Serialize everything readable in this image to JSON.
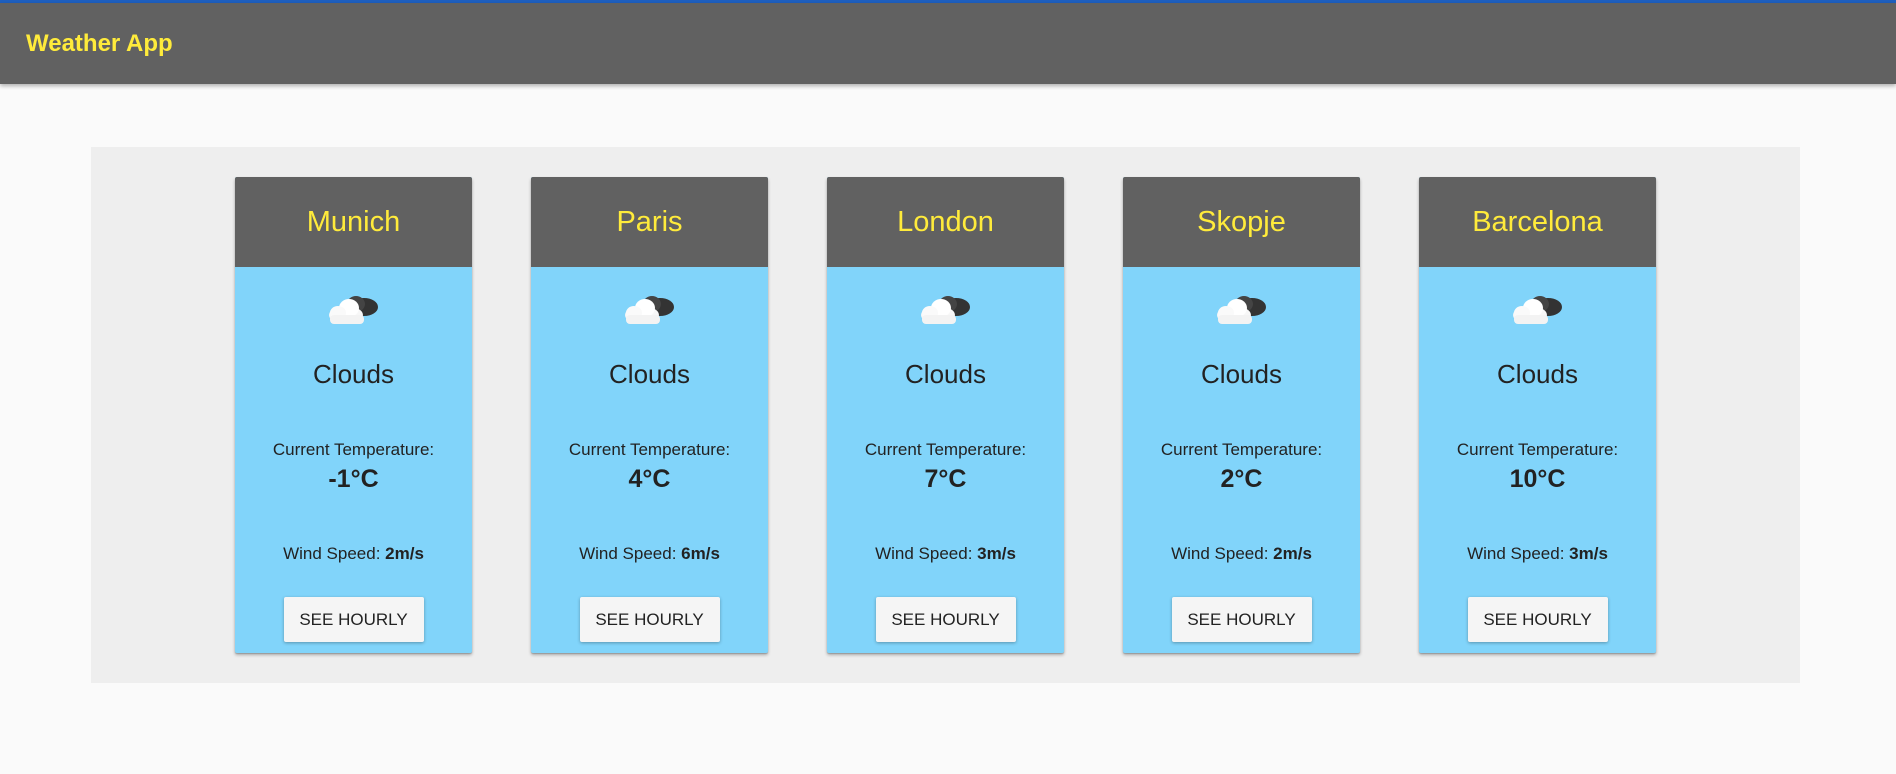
{
  "app": {
    "title": "Weather App"
  },
  "labels": {
    "temperature_label": "Current Temperature:",
    "wind_label": "Wind Speed:",
    "hourly_button": "SEE HOURLY"
  },
  "icons": {
    "weather": "cloud-icon"
  },
  "colors": {
    "header_bg": "#616161",
    "accent_text": "#ffeb3b",
    "card_bg": "#81d4fa",
    "panel_bg": "#eeeeee",
    "top_border": "#1e5fbf"
  },
  "cities": [
    {
      "name": "Munich",
      "condition": "Clouds",
      "temperature": "-1°C",
      "wind": "2m/s"
    },
    {
      "name": "Paris",
      "condition": "Clouds",
      "temperature": "4°C",
      "wind": "6m/s"
    },
    {
      "name": "London",
      "condition": "Clouds",
      "temperature": "7°C",
      "wind": "3m/s"
    },
    {
      "name": "Skopje",
      "condition": "Clouds",
      "temperature": "2°C",
      "wind": "2m/s"
    },
    {
      "name": "Barcelona",
      "condition": "Clouds",
      "temperature": "10°C",
      "wind": "3m/s"
    }
  ]
}
